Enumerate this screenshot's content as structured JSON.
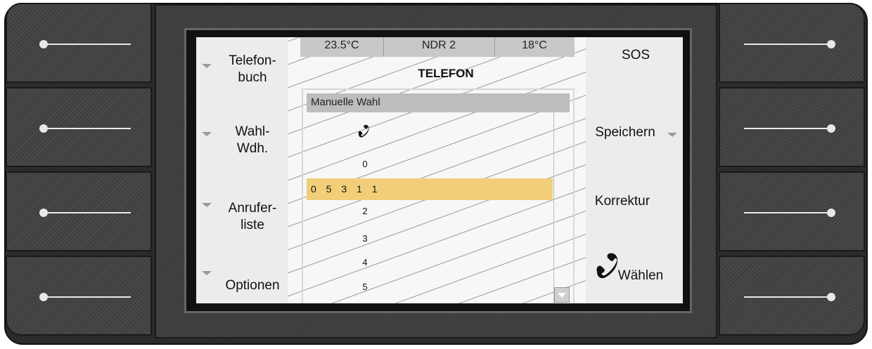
{
  "softkeys_left": [
    "Telefon-\nbuch",
    "Wahl-\nWdh.",
    "Anrufer-\nliste",
    "Optionen"
  ],
  "softkeys_right": [
    "SOS",
    "Speichern",
    "Korrektur",
    "Wählen"
  ],
  "status": {
    "temp_left": "23.5°C",
    "station": "NDR 2",
    "temp_right": "18°C"
  },
  "title": "TELEFON",
  "panel": {
    "header": "Manuelle Wahl"
  },
  "dial": {
    "entry": "0 5 3 1 1",
    "digits_above": [
      "0"
    ],
    "digits_below": [
      "2",
      "3",
      "4",
      "5"
    ]
  },
  "icons": {
    "handset": "phone-handset-icon",
    "scroll": "scroll-down-icon"
  },
  "colors": {
    "highlight": "#f1cf79",
    "bezel": "#2b2b2b"
  }
}
